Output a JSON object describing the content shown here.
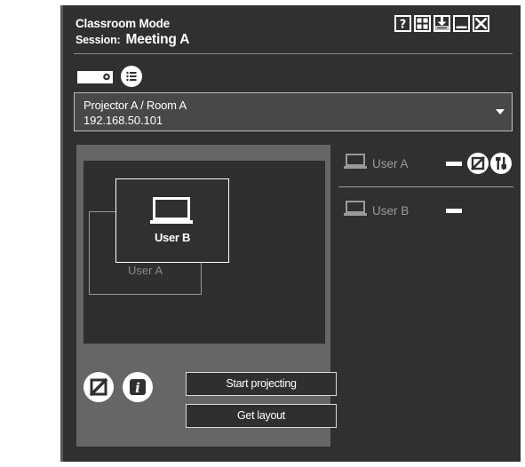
{
  "header": {
    "app_title": "Classroom Mode",
    "session_label": "Session:",
    "session_name": "Meeting A"
  },
  "toolbar": {
    "icons": [
      "help-icon",
      "grid-layout-icon",
      "download-icon",
      "minimize-icon",
      "close-icon"
    ]
  },
  "projector": {
    "name": "Projector A / Room A",
    "ip": "192.168.50.101"
  },
  "layout": {
    "user_a_label": "User A",
    "user_b_label": "User B"
  },
  "actions": {
    "start_projecting": "Start projecting",
    "get_layout": "Get layout"
  },
  "users": [
    {
      "name": "User A",
      "icons": [
        "laptop-icon",
        "status-indicator",
        "stop-icon",
        "tools-icon"
      ]
    },
    {
      "name": "User B",
      "icons": [
        "laptop-icon",
        "status-indicator"
      ]
    }
  ],
  "colors": {
    "window_bg": "#303030",
    "panel_bg": "#666666",
    "dropdown_bg": "#484848",
    "text": "#ffffff",
    "muted_text": "#9a9a9a"
  }
}
